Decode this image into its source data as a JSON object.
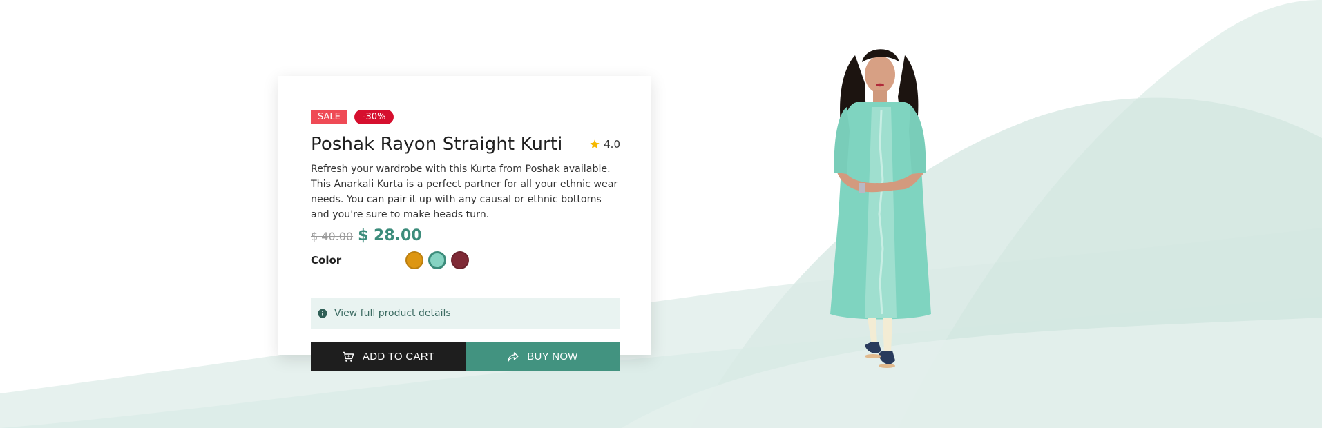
{
  "product": {
    "badges": {
      "sale": "SALE",
      "discount": "-30%"
    },
    "title": "Poshak Rayon Straight Kurti",
    "rating": {
      "value": "4.0",
      "icon": "star-icon",
      "icon_color": "#f5b800"
    },
    "description": "Refresh your wardrobe with this Kurta from Poshak available. This Anarkali Kurta is a perfect partner for all your ethnic wear needs. You can pair it up with any causal or ethnic bottoms and you're sure to make heads turn.",
    "price": {
      "old": "$ 40.00",
      "new": "$ 28.00"
    },
    "color": {
      "label": "Color",
      "options": [
        {
          "name": "mustard",
          "hex": "#dd9612",
          "selected": false
        },
        {
          "name": "aqua",
          "hex": "#86d3c2",
          "selected": true
        },
        {
          "name": "maroon",
          "hex": "#7f2a36",
          "selected": false
        }
      ]
    },
    "details_link": {
      "icon": "info-icon",
      "label": "View full product details"
    },
    "actions": {
      "add_to_cart": {
        "label": "ADD TO CART",
        "icon": "cart-icon"
      },
      "buy_now": {
        "label": "BUY NOW",
        "icon": "share-forward-icon"
      }
    }
  },
  "theme": {
    "accent": "#429380",
    "sale_badge": "#ef4a55",
    "discount_badge": "#d60f2e",
    "dark_button": "#1e1e1e",
    "wave": "#d8ebe6"
  }
}
